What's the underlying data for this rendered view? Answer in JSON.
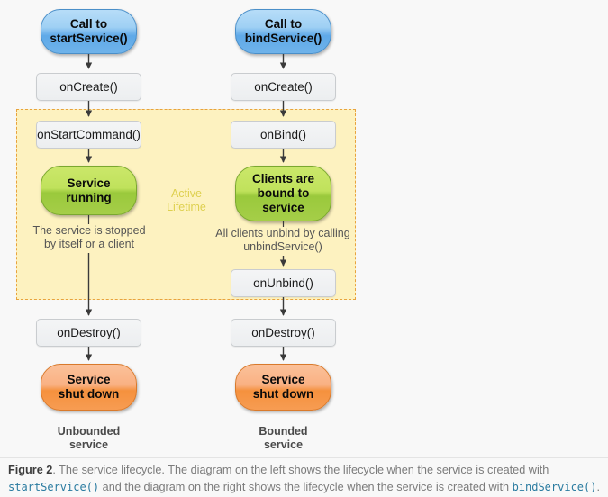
{
  "figure": {
    "background_color": "#f8f8f8",
    "active_region": {
      "label_line1": "Active",
      "label_line2": "Lifetime",
      "fill_color": "#fdf2c0",
      "border_color": "#e8a33d"
    },
    "caption": {
      "label": "Figure 2",
      "text_part1": ". The service lifecycle. The diagram on the left shows the lifecycle when the service is created with ",
      "code1": "startService()",
      "text_part2": " and the diagram on the right shows the lifecycle when the service is created with ",
      "code2": "bindService()",
      "text_part3": ".",
      "code_color": "#2a7ba0"
    }
  },
  "columns": [
    {
      "id": "unbounded",
      "footer_line1": "Unbounded",
      "footer_line2": "service",
      "nodes": [
        {
          "id": "start-call",
          "kind": "capsule",
          "color": "blue",
          "accent": "#5fa9e8",
          "line1": "Call to",
          "line2": "startService()"
        },
        {
          "id": "on-create",
          "kind": "box",
          "color": "gray",
          "accent": "#eceef0",
          "line1": "onCreate()"
        },
        {
          "id": "on-start-command",
          "kind": "box",
          "color": "gray",
          "accent": "#eceef0",
          "line1": "onStartCommand()"
        },
        {
          "id": "service-running",
          "kind": "capsule",
          "color": "green",
          "accent": "#9ac93c",
          "line1": "Service",
          "line2": "running"
        },
        {
          "id": "on-destroy",
          "kind": "box",
          "color": "gray",
          "accent": "#eceef0",
          "line1": "onDestroy()"
        },
        {
          "id": "service-shut-down",
          "kind": "capsule",
          "color": "orange",
          "accent": "#f5913d",
          "line1": "Service",
          "line2": "shut down"
        }
      ],
      "annotation": {
        "line1": "The service is stopped",
        "line2": "by itself or a client"
      }
    },
    {
      "id": "bounded",
      "footer_line1": "Bounded",
      "footer_line2": "service",
      "nodes": [
        {
          "id": "bind-call",
          "kind": "capsule",
          "color": "blue",
          "accent": "#5fa9e8",
          "line1": "Call to",
          "line2": "bindService()"
        },
        {
          "id": "on-create",
          "kind": "box",
          "color": "gray",
          "accent": "#eceef0",
          "line1": "onCreate()"
        },
        {
          "id": "on-bind",
          "kind": "box",
          "color": "gray",
          "accent": "#eceef0",
          "line1": "onBind()"
        },
        {
          "id": "clients-bound",
          "kind": "capsule",
          "color": "green",
          "accent": "#9ac93c",
          "line1": "Clients are",
          "line2": "bound to",
          "line3": "service"
        },
        {
          "id": "on-unbind",
          "kind": "box",
          "color": "gray",
          "accent": "#eceef0",
          "line1": "onUnbind()"
        },
        {
          "id": "on-destroy",
          "kind": "box",
          "color": "gray",
          "accent": "#eceef0",
          "line1": "onDestroy()"
        },
        {
          "id": "service-shut-down",
          "kind": "capsule",
          "color": "orange",
          "accent": "#f5913d",
          "line1": "Service",
          "line2": "shut down"
        }
      ],
      "annotation": {
        "line1": "All clients unbind by calling",
        "line2": "unbindService()"
      }
    }
  ]
}
